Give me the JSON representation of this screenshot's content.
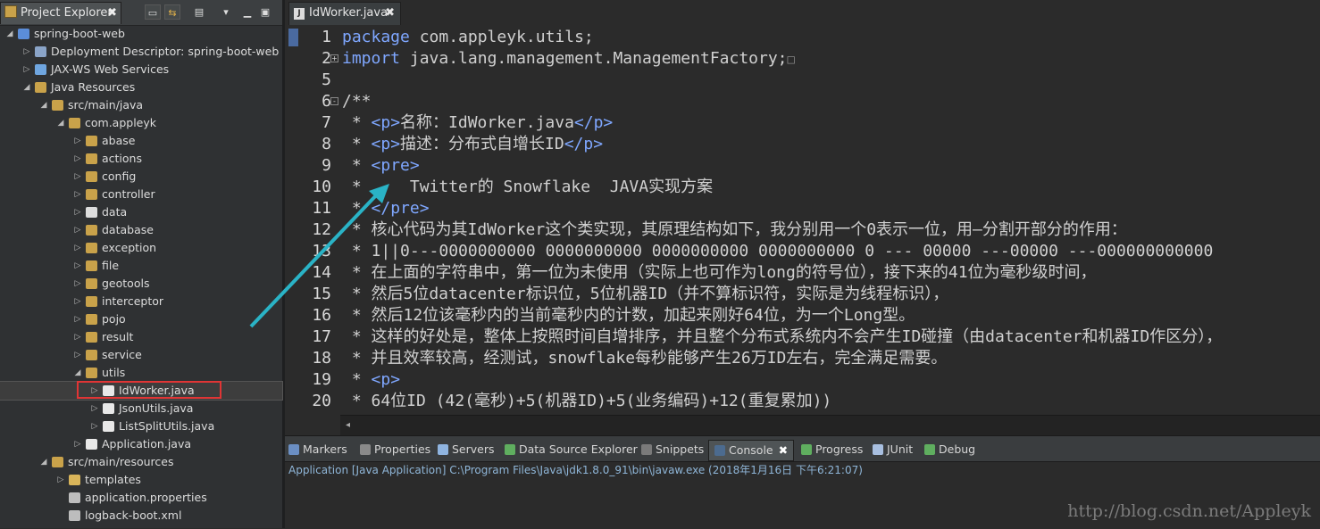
{
  "left_panel": {
    "tab_label": "Project Explorer",
    "close_glyph": "✖",
    "tree": [
      {
        "label": "spring-boot-web",
        "depth": 0,
        "arrow": "◢",
        "icon": "project-icon",
        "color": "#5b8dd9"
      },
      {
        "label": "Deployment Descriptor: spring-boot-web",
        "depth": 1,
        "arrow": "▷",
        "icon": "descriptor-icon",
        "color": "#8aa4c8"
      },
      {
        "label": "JAX-WS Web Services",
        "depth": 1,
        "arrow": "▷",
        "icon": "webservice-icon",
        "color": "#6fa6e0"
      },
      {
        "label": "Java Resources",
        "depth": 1,
        "arrow": "◢",
        "icon": "java-resources-icon",
        "color": "#c9a24a"
      },
      {
        "label": "src/main/java",
        "depth": 2,
        "arrow": "◢",
        "icon": "source-folder-icon",
        "color": "#c9a24a"
      },
      {
        "label": "com.appleyk",
        "depth": 3,
        "arrow": "◢",
        "icon": "package-icon",
        "color": "#c9a24a"
      },
      {
        "label": "abase",
        "depth": 4,
        "arrow": "▷",
        "icon": "package-icon",
        "color": "#c9a24a"
      },
      {
        "label": "actions",
        "depth": 4,
        "arrow": "▷",
        "icon": "package-icon",
        "color": "#c9a24a"
      },
      {
        "label": "config",
        "depth": 4,
        "arrow": "▷",
        "icon": "package-icon",
        "color": "#c9a24a"
      },
      {
        "label": "controller",
        "depth": 4,
        "arrow": "▷",
        "icon": "package-icon",
        "color": "#c9a24a"
      },
      {
        "label": "data",
        "depth": 4,
        "arrow": "▷",
        "icon": "package-icon",
        "color": "#dddddd"
      },
      {
        "label": "database",
        "depth": 4,
        "arrow": "▷",
        "icon": "package-icon",
        "color": "#c9a24a"
      },
      {
        "label": "exception",
        "depth": 4,
        "arrow": "▷",
        "icon": "package-icon",
        "color": "#c9a24a"
      },
      {
        "label": "file",
        "depth": 4,
        "arrow": "▷",
        "icon": "package-icon",
        "color": "#c9a24a"
      },
      {
        "label": "geotools",
        "depth": 4,
        "arrow": "▷",
        "icon": "package-icon",
        "color": "#c9a24a"
      },
      {
        "label": "interceptor",
        "depth": 4,
        "arrow": "▷",
        "icon": "package-icon",
        "color": "#c9a24a"
      },
      {
        "label": "pojo",
        "depth": 4,
        "arrow": "▷",
        "icon": "package-icon",
        "color": "#c9a24a"
      },
      {
        "label": "result",
        "depth": 4,
        "arrow": "▷",
        "icon": "package-icon",
        "color": "#c9a24a"
      },
      {
        "label": "service",
        "depth": 4,
        "arrow": "▷",
        "icon": "package-icon",
        "color": "#c9a24a"
      },
      {
        "label": "utils",
        "depth": 4,
        "arrow": "◢",
        "icon": "package-icon",
        "color": "#c9a24a"
      },
      {
        "label": "IdWorker.java",
        "depth": 5,
        "arrow": "▷",
        "icon": "java-file-icon",
        "color": "#e8e8e8",
        "selected": true
      },
      {
        "label": "JsonUtils.java",
        "depth": 5,
        "arrow": "▷",
        "icon": "java-file-icon",
        "color": "#e8e8e8"
      },
      {
        "label": "ListSplitUtils.java",
        "depth": 5,
        "arrow": "▷",
        "icon": "java-file-icon",
        "color": "#e8e8e8"
      },
      {
        "label": "Application.java",
        "depth": 4,
        "arrow": "▷",
        "icon": "java-file-icon",
        "color": "#e8e8e8"
      },
      {
        "label": "src/main/resources",
        "depth": 2,
        "arrow": "◢",
        "icon": "source-folder-icon",
        "color": "#c9a24a"
      },
      {
        "label": "templates",
        "depth": 3,
        "arrow": "▷",
        "icon": "folder-icon",
        "color": "#d9b55a"
      },
      {
        "label": "application.properties",
        "depth": 3,
        "arrow": "",
        "icon": "properties-file-icon",
        "color": "#bdbdbd"
      },
      {
        "label": "logback-boot.xml",
        "depth": 3,
        "arrow": "",
        "icon": "xml-file-icon",
        "color": "#bdbdbd"
      }
    ]
  },
  "editor": {
    "tab_label": "IdWorker.java",
    "close_glyph": "✖",
    "lines": [
      {
        "n": "1",
        "parts": [
          {
            "t": "package",
            "c": "kw"
          },
          {
            "t": " com.appleyk.utils;"
          }
        ]
      },
      {
        "n": "2",
        "parts": [
          {
            "t": "import",
            "c": "kw"
          },
          {
            "t": " java.lang.management.ManagementFactory;"
          },
          {
            "t": "□",
            "c": "box"
          }
        ]
      },
      {
        "n": "5",
        "parts": [
          {
            "t": ""
          }
        ]
      },
      {
        "n": "6",
        "parts": [
          {
            "t": "/**"
          }
        ]
      },
      {
        "n": "7",
        "parts": [
          {
            "t": " * "
          },
          {
            "t": "<p>",
            "c": "tag"
          },
          {
            "t": "名称：IdWorker.java"
          },
          {
            "t": "</p>",
            "c": "tag"
          }
        ]
      },
      {
        "n": "8",
        "parts": [
          {
            "t": " * "
          },
          {
            "t": "<p>",
            "c": "tag"
          },
          {
            "t": "描述：分布式自增长ID"
          },
          {
            "t": "</p>",
            "c": "tag"
          }
        ]
      },
      {
        "n": "9",
        "parts": [
          {
            "t": " * "
          },
          {
            "t": "<pre>",
            "c": "tag"
          }
        ]
      },
      {
        "n": "10",
        "parts": [
          {
            "t": " *     Twitter的 Snowflake  JAVA实现方案"
          }
        ]
      },
      {
        "n": "11",
        "parts": [
          {
            "t": " * "
          },
          {
            "t": "</pre>",
            "c": "tag"
          }
        ]
      },
      {
        "n": "12",
        "parts": [
          {
            "t": " * 核心代码为其IdWorker这个类实现，其原理结构如下，我分别用一个0表示一位，用—分割开部分的作用："
          }
        ]
      },
      {
        "n": "13",
        "parts": [
          {
            "t": " * 1||0---0000000000 0000000000 0000000000 0000000000 0 --- 00000 ---00000 ---000000000000"
          }
        ]
      },
      {
        "n": "14",
        "parts": [
          {
            "t": " * 在上面的字符串中，第一位为未使用（实际上也可作为long的符号位），接下来的41位为毫秒级时间，"
          }
        ]
      },
      {
        "n": "15",
        "parts": [
          {
            "t": " * 然后5位datacenter标识位，5位机器ID（并不算标识符，实际是为线程标识），"
          }
        ]
      },
      {
        "n": "16",
        "parts": [
          {
            "t": " * 然后12位该毫秒内的当前毫秒内的计数，加起来刚好64位，为一个Long型。"
          }
        ]
      },
      {
        "n": "17",
        "parts": [
          {
            "t": " * 这样的好处是，整体上按照时间自增排序，并且整个分布式系统内不会产生ID碰撞（由datacenter和机器ID作区分），"
          }
        ]
      },
      {
        "n": "18",
        "parts": [
          {
            "t": " * 并且效率较高，经测试，snowflake每秒能够产生26万ID左右，完全满足需要。"
          }
        ]
      },
      {
        "n": "19",
        "parts": [
          {
            "t": " * "
          },
          {
            "t": "<p>",
            "c": "tag"
          }
        ]
      },
      {
        "n": "20",
        "parts": [
          {
            "t": " * 64位ID (42(毫秒)+5(机器ID)+5(业务编码)+12(重复累加))"
          }
        ]
      }
    ],
    "fold_markers": {
      "line2": "+",
      "line6": "-"
    },
    "hscroll_glyph": "◂"
  },
  "bottom_panel": {
    "tabs": [
      {
        "label": "Markers",
        "icon": "markers-icon",
        "color": "#6b8fc4"
      },
      {
        "label": "Properties",
        "icon": "properties-icon",
        "color": "#8a8a8a"
      },
      {
        "label": "Servers",
        "icon": "servers-icon",
        "color": "#8fb4e0"
      },
      {
        "label": "Data Source Explorer",
        "icon": "data-source-icon",
        "color": "#5fae5f"
      },
      {
        "label": "Snippets",
        "icon": "snippets-icon",
        "color": "#7a7a7a"
      },
      {
        "label": "Console",
        "icon": "console-icon",
        "color": "#4c6b8f",
        "active": true
      },
      {
        "label": "Progress",
        "icon": "progress-icon",
        "color": "#5fae5f"
      },
      {
        "label": "JUnit",
        "icon": "junit-icon",
        "color": "#a8bfe0"
      },
      {
        "label": "Debug",
        "icon": "debug-icon",
        "color": "#5fae5f"
      }
    ],
    "console_line": "Application [Java Application] C:\\Program Files\\Java\\jdk1.8.0_91\\bin\\javaw.exe (2018年1月16日 下午6:21:07)"
  },
  "watermark": "http://blog.csdn.net/Appleyk",
  "colors": {
    "keyword": "#7fa7ff",
    "highlight_box": "#e03535",
    "arrow": "#2ab3c6"
  }
}
